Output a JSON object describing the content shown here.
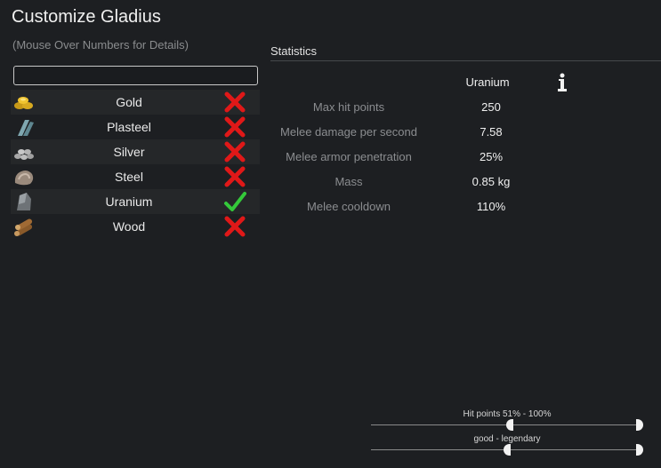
{
  "window": {
    "title": "Customize Gladius",
    "subtitle": "(Mouse Over Numbers for Details)"
  },
  "search": {
    "value": "",
    "placeholder": ""
  },
  "materials": [
    {
      "label": "Gold",
      "icon": "gold-icon",
      "allowed": false
    },
    {
      "label": "Plasteel",
      "icon": "plasteel-icon",
      "allowed": false
    },
    {
      "label": "Silver",
      "icon": "silver-icon",
      "allowed": false
    },
    {
      "label": "Steel",
      "icon": "steel-icon",
      "allowed": false
    },
    {
      "label": "Uranium",
      "icon": "uranium-icon",
      "allowed": true
    },
    {
      "label": "Wood",
      "icon": "wood-icon",
      "allowed": false
    }
  ],
  "statistics": {
    "header": "Statistics",
    "column_title": "Uranium",
    "info_icon": "info-icon",
    "rows": [
      {
        "label": "Max hit points",
        "value": "250"
      },
      {
        "label": "Melee damage per second",
        "value": "7.58"
      },
      {
        "label": "Melee armor penetration",
        "value": "25%"
      },
      {
        "label": "Mass",
        "value": "0.85 kg"
      },
      {
        "label": "Melee cooldown",
        "value": "110%"
      }
    ]
  },
  "filters": {
    "hitpoints": {
      "label": "Hit points 51% - 100%",
      "low": 0.51,
      "high": 1.0
    },
    "quality": {
      "label": "good - legendary",
      "low": 0.5,
      "high": 1.0
    }
  },
  "colors": {
    "background": "#1d1f22",
    "allowed": "#34c93a",
    "disallowed": "#e01818",
    "muted_text": "#8b8d90"
  }
}
